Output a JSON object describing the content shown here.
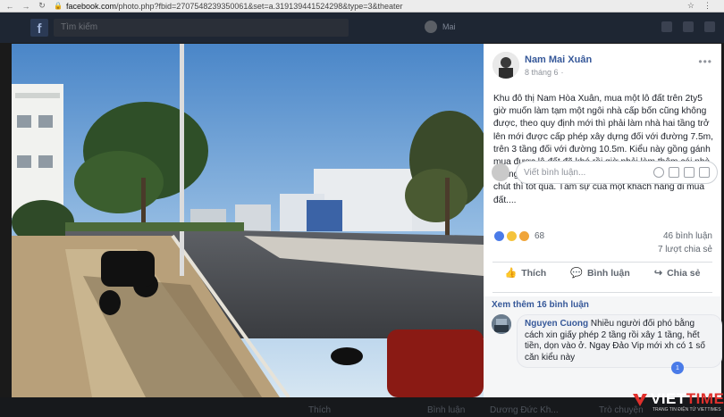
{
  "browser": {
    "url_host": "facebook.com",
    "url_path": "/photo.php?fbid=2707548239350061&set=a.319139441524298&type=3&theater"
  },
  "fb_header": {
    "search_placeholder": "Tìm kiếm",
    "user_name": "Mai"
  },
  "post": {
    "author": "Nam Mai Xuân",
    "date": "8 tháng 6",
    "text": "Khu đô thị Nam Hòa Xuân, mua một lô đất trên 2ty5 giờ muốn làm tạm một ngôi nhà cấp bốn cũng không được, theo quy định mới thì phải làm nhà hai tầng trở lên mới được cấp phép xây dựng đối với đường 7.5m, trên 3 tầng đối với đường 10.5m. Kiểu này gồng gánh mua được lô đất đã khó rồi giờ phải làm thêm cái nhà 2 tầng nữa càng khó hơn...., Nếu như giá đất rẻ một chút thì tốt quá. Tâm sự của một khách hàng đi mua đất....",
    "reaction_count": "68",
    "comments_count": "46 bình luận",
    "shares_count": "7 lượt chia sẻ",
    "actions": {
      "like": "Thích",
      "comment": "Bình luận",
      "share": "Chia sẻ"
    }
  },
  "comments": {
    "view_more": "Xem thêm 16 bình luận",
    "items": [
      {
        "name": "Nguyen Cuong",
        "text": "Nhiều người đối phó bằng cách xin giấy phép 2 tầng rồi xây 1 tầng, hết tiền, dọn vào ở. Ngay Đảo Vip mới xh có 1 số căn kiểu này",
        "likes": "1"
      }
    ],
    "write_placeholder": "Viết bình luận..."
  },
  "bottom_strip": {
    "like": "Thích",
    "comment": "Bình luận",
    "user": "Dương Đức Kh...",
    "right": "Trò chuyện"
  },
  "watermark": {
    "brand_viet": "VIET",
    "brand_times": "TIMES",
    "tagline": "TRANG TIN ĐIỆN TỬ VIETTIMES"
  },
  "colors": {
    "fb_blue": "#365899",
    "reaction_like": "#4a7be8",
    "brand_red": "#e0302c"
  }
}
